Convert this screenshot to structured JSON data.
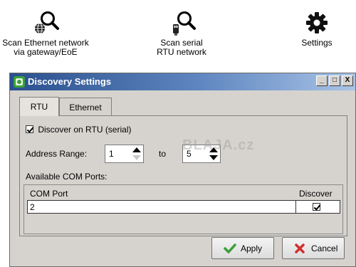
{
  "toolbar": {
    "items": [
      {
        "label": "Scan Ethernet network\nvia gateway/EoE",
        "icon": "globe-search-icon"
      },
      {
        "label": "Scan serial\nRTU network",
        "icon": "serial-search-icon"
      },
      {
        "label": "Settings",
        "icon": "gear-icon"
      }
    ]
  },
  "dialog": {
    "title": "Discovery Settings",
    "window_buttons": {
      "minimize": "_",
      "maximize": "□",
      "close": "X"
    },
    "tabs": [
      {
        "label": "RTU",
        "active": true
      },
      {
        "label": "Ethernet",
        "active": false
      }
    ],
    "rtu": {
      "discover_label": "Discover on RTU (serial)",
      "discover_checked": true,
      "address_range_label": "Address Range:",
      "range_from": "1",
      "range_to_label": "to",
      "range_to": "5",
      "available_ports_label": "Available COM Ports:",
      "grid": {
        "columns": [
          "COM Port",
          "Discover"
        ],
        "rows": [
          {
            "port": "2",
            "discover": true
          }
        ]
      }
    },
    "watermark": "BLAJA.cz",
    "buttons": {
      "apply": "Apply",
      "cancel": "Cancel"
    }
  },
  "colors": {
    "title_gradient_start": "#2a4f8e",
    "dialog_bg": "#d6d3ce",
    "apply_check": "#3aa03a",
    "cancel_x": "#d03030"
  }
}
